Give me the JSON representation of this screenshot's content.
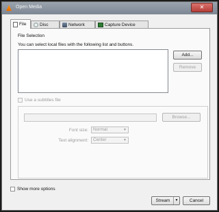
{
  "window": {
    "title": "Open Media",
    "close_glyph": "✕"
  },
  "tabs": [
    {
      "label": "File",
      "icon": "file-icon"
    },
    {
      "label": "Disc",
      "icon": "disc-icon"
    },
    {
      "label": "Network",
      "icon": "network-icon"
    },
    {
      "label": "Capture Device",
      "icon": "capture-device-icon"
    }
  ],
  "file_selection": {
    "heading": "File Selection",
    "description": "You can select local files with the following list and buttons.",
    "add_label": "Add...",
    "remove_label": "Remove"
  },
  "subtitles": {
    "checkbox_label": "Use a subtitles file",
    "browse_label": "Browse...",
    "font_size_label": "Font size:",
    "font_size_value": "Normal",
    "text_alignment_label": "Text alignment:",
    "text_alignment_value": "Center"
  },
  "footer": {
    "show_more_label": "Show more options",
    "stream_label": "Stream",
    "stream_arrow": "▼",
    "cancel_label": "Cancel"
  }
}
